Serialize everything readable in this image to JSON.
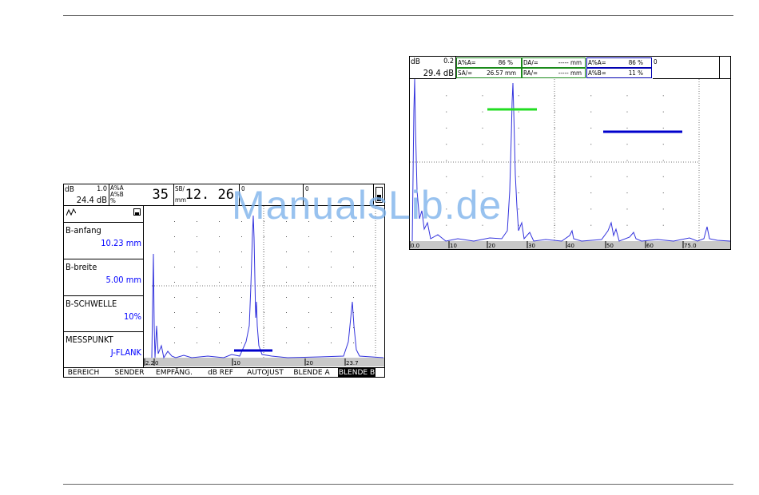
{
  "watermark": "ManualsLib.de",
  "left_screen": {
    "header": {
      "db_label": "dB",
      "db_step": "1.0",
      "db_value": "24.4 dB",
      "amp_label_a": "A%A",
      "amp_label_b": "A%B",
      "amp_unit": "%",
      "amp_value": "35",
      "sb_label": "SB/",
      "sb_unit": "mm",
      "sb_value": "12. 26",
      "field_a": "0",
      "field_b": "0"
    },
    "panels": [
      {
        "label": "B-anfang",
        "value": "10.23 mm"
      },
      {
        "label": "B-breite",
        "value": "5.00 mm"
      },
      {
        "label": "B-SCHWELLE",
        "value": "10%"
      },
      {
        "label": "MESSPUNKT",
        "value": "J-FLANK"
      }
    ],
    "scale": [
      "2.2",
      "0",
      "10",
      "20",
      "23.7"
    ],
    "menu": [
      "BEREICH",
      "SENDER",
      "EMPFÄNG.",
      "dB REF",
      "AUTOJUST",
      "BLENDE A",
      "BLENDE B"
    ],
    "active_menu": "BLENDE B",
    "colors": {
      "gate_b": "#0000cc",
      "signal": "#3333dd"
    }
  },
  "right_screen": {
    "header": {
      "db_label": "dB",
      "db_step": "0.2",
      "db_value": "29.4 dB",
      "r1_label": "A%A=",
      "r1_value": "86 %",
      "r2_label": "SA/=",
      "r2_value": "26.57 mm",
      "r3_label": "DA/=",
      "r3_value": "----- mm",
      "r4_label": "RA/=",
      "r4_value": "----- mm",
      "r5_label": "A%A=",
      "r5_value": "86 %",
      "r6_label": "A%B=",
      "r6_value": "11 %",
      "field_right": "0"
    },
    "scale": [
      "0.0",
      "10",
      "20",
      "30",
      "40",
      "50",
      "60",
      "75.0"
    ],
    "colors": {
      "gate_a": "#22dd22",
      "gate_b": "#0000cc",
      "signal": "#3333dd"
    }
  }
}
